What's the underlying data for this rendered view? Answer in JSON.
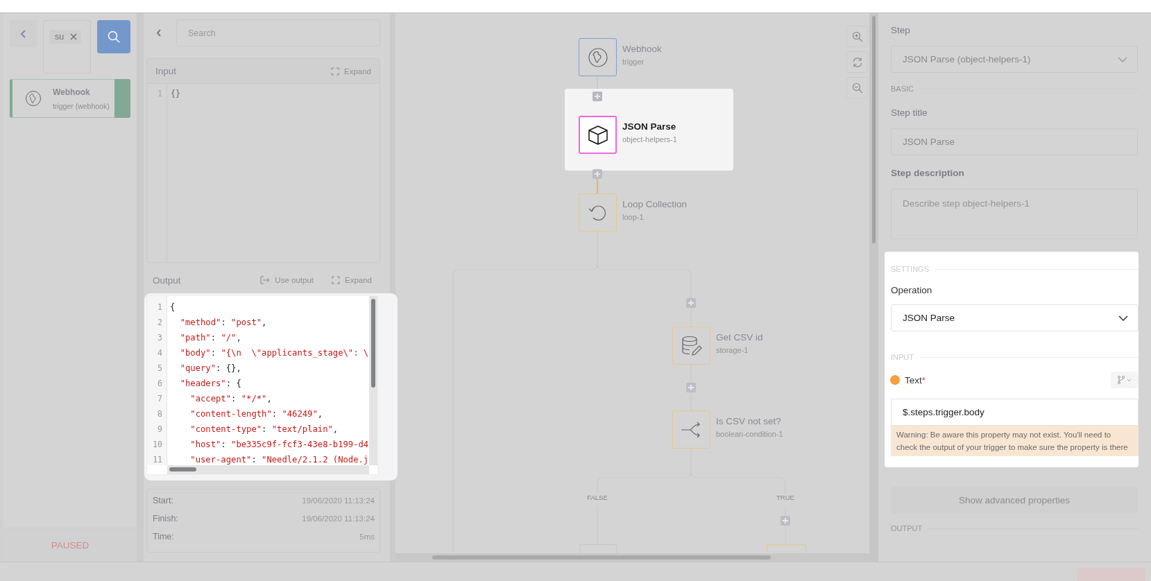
{
  "sidebar": {
    "filter_tags": [
      {
        "label": "su"
      }
    ],
    "steps": [
      {
        "title": "Webhook",
        "subtitle": "trigger (webhook)",
        "selected": true
      }
    ],
    "status": "PAUSED"
  },
  "inspector": {
    "search": {
      "placeholder": "Search"
    },
    "input": {
      "title": "Input",
      "expand": "Expand",
      "lines": [
        {
          "no": "1",
          "tokens": [
            {
              "text": "{}",
              "kind": "punct"
            }
          ]
        }
      ]
    },
    "output": {
      "title": "Output",
      "use_output": "Use output",
      "expand": "Expand",
      "lines": [
        {
          "no": "1",
          "tokens": [
            {
              "text": "{",
              "kind": "punct"
            }
          ]
        },
        {
          "no": "2",
          "tokens": [
            {
              "text": "  \"method\"",
              "kind": "str"
            },
            {
              "text": ": ",
              "kind": "punct"
            },
            {
              "text": "\"post\"",
              "kind": "str"
            },
            {
              "text": ",",
              "kind": "punct"
            }
          ]
        },
        {
          "no": "3",
          "tokens": [
            {
              "text": "  \"path\"",
              "kind": "str"
            },
            {
              "text": ": ",
              "kind": "punct"
            },
            {
              "text": "\"/\"",
              "kind": "str"
            },
            {
              "text": ",",
              "kind": "punct"
            }
          ]
        },
        {
          "no": "4",
          "tokens": [
            {
              "text": "  \"body\"",
              "kind": "str"
            },
            {
              "text": ": ",
              "kind": "punct"
            },
            {
              "text": "\"{\\n  \\\"applicants_stage\\\": \\",
              "kind": "str"
            }
          ]
        },
        {
          "no": "5",
          "tokens": [
            {
              "text": "  \"query\"",
              "kind": "str"
            },
            {
              "text": ": {},",
              "kind": "punct"
            }
          ]
        },
        {
          "no": "6",
          "tokens": [
            {
              "text": "  \"headers\"",
              "kind": "str"
            },
            {
              "text": ": {",
              "kind": "punct"
            }
          ]
        },
        {
          "no": "7",
          "tokens": [
            {
              "text": "    \"accept\"",
              "kind": "str"
            },
            {
              "text": ": ",
              "kind": "punct"
            },
            {
              "text": "\"*/*\"",
              "kind": "str"
            },
            {
              "text": ",",
              "kind": "punct"
            }
          ]
        },
        {
          "no": "8",
          "tokens": [
            {
              "text": "    \"content-length\"",
              "kind": "str"
            },
            {
              "text": ": ",
              "kind": "punct"
            },
            {
              "text": "\"46249\"",
              "kind": "str"
            },
            {
              "text": ",",
              "kind": "punct"
            }
          ]
        },
        {
          "no": "9",
          "tokens": [
            {
              "text": "    \"content-type\"",
              "kind": "str"
            },
            {
              "text": ": ",
              "kind": "punct"
            },
            {
              "text": "\"text/plain\"",
              "kind": "str"
            },
            {
              "text": ",",
              "kind": "punct"
            }
          ]
        },
        {
          "no": "10",
          "tokens": [
            {
              "text": "    \"host\"",
              "kind": "str"
            },
            {
              "text": ": ",
              "kind": "punct"
            },
            {
              "text": "\"be335c9f-fcf3-43e8-b199-d4",
              "kind": "str"
            }
          ]
        },
        {
          "no": "11",
          "tokens": [
            {
              "text": "    \"user-agent\"",
              "kind": "str"
            },
            {
              "text": ": ",
              "kind": "punct"
            },
            {
              "text": "\"Needle/2.1.2 (Node.j",
              "kind": "str"
            }
          ]
        }
      ]
    },
    "stats": [
      {
        "label": "Start:",
        "value": "19/06/2020 11:13:24"
      },
      {
        "label": "Finish:",
        "value": "19/06/2020 11:13:24"
      },
      {
        "label": "Time:",
        "value": "5ms"
      }
    ]
  },
  "canvas": {
    "nodes": [
      {
        "title": "Webhook",
        "subtitle": "trigger",
        "kind": "globe",
        "color": "#7b9fd9",
        "selected": false
      },
      {
        "title": "JSON Parse",
        "subtitle": "object-helpers-1",
        "kind": "cube",
        "color": "#f066e6",
        "selected": true
      },
      {
        "title": "Loop Collection",
        "subtitle": "loop-1",
        "kind": "loop",
        "color": "#e6c88a",
        "selected": false
      },
      {
        "title": "Get CSV id",
        "subtitle": "storage-1",
        "kind": "storage",
        "color": "#e6c88a",
        "selected": false
      },
      {
        "title": "Is CSV not set?",
        "subtitle": "boolean-condition-1",
        "kind": "branch",
        "color": "#e6c88a",
        "selected": false
      }
    ],
    "branches": [
      {
        "label": "FALSE"
      },
      {
        "label": "TRUE"
      }
    ]
  },
  "properties": {
    "step_label": "Step",
    "step_value": "JSON Parse (object-helpers-1)",
    "basic_section": "BASIC",
    "title_label": "Step title",
    "title_value": "JSON Parse",
    "description_label": "Step description",
    "description_placeholder": "Describe step object-helpers-1",
    "settings_section": "SETTINGS",
    "operation_label": "Operation",
    "operation_value": "JSON Parse",
    "input_section": "INPUT",
    "field": {
      "label": "Text",
      "required_mark": "*",
      "color": "#f5a03a",
      "value": "$.steps.trigger.body",
      "warning": "Warning: Be aware this property may not exist. You'll need to check the output of your trigger to make sure the property is there"
    },
    "advanced_button": "Show advanced properties",
    "output_section": "OUTPUT"
  }
}
